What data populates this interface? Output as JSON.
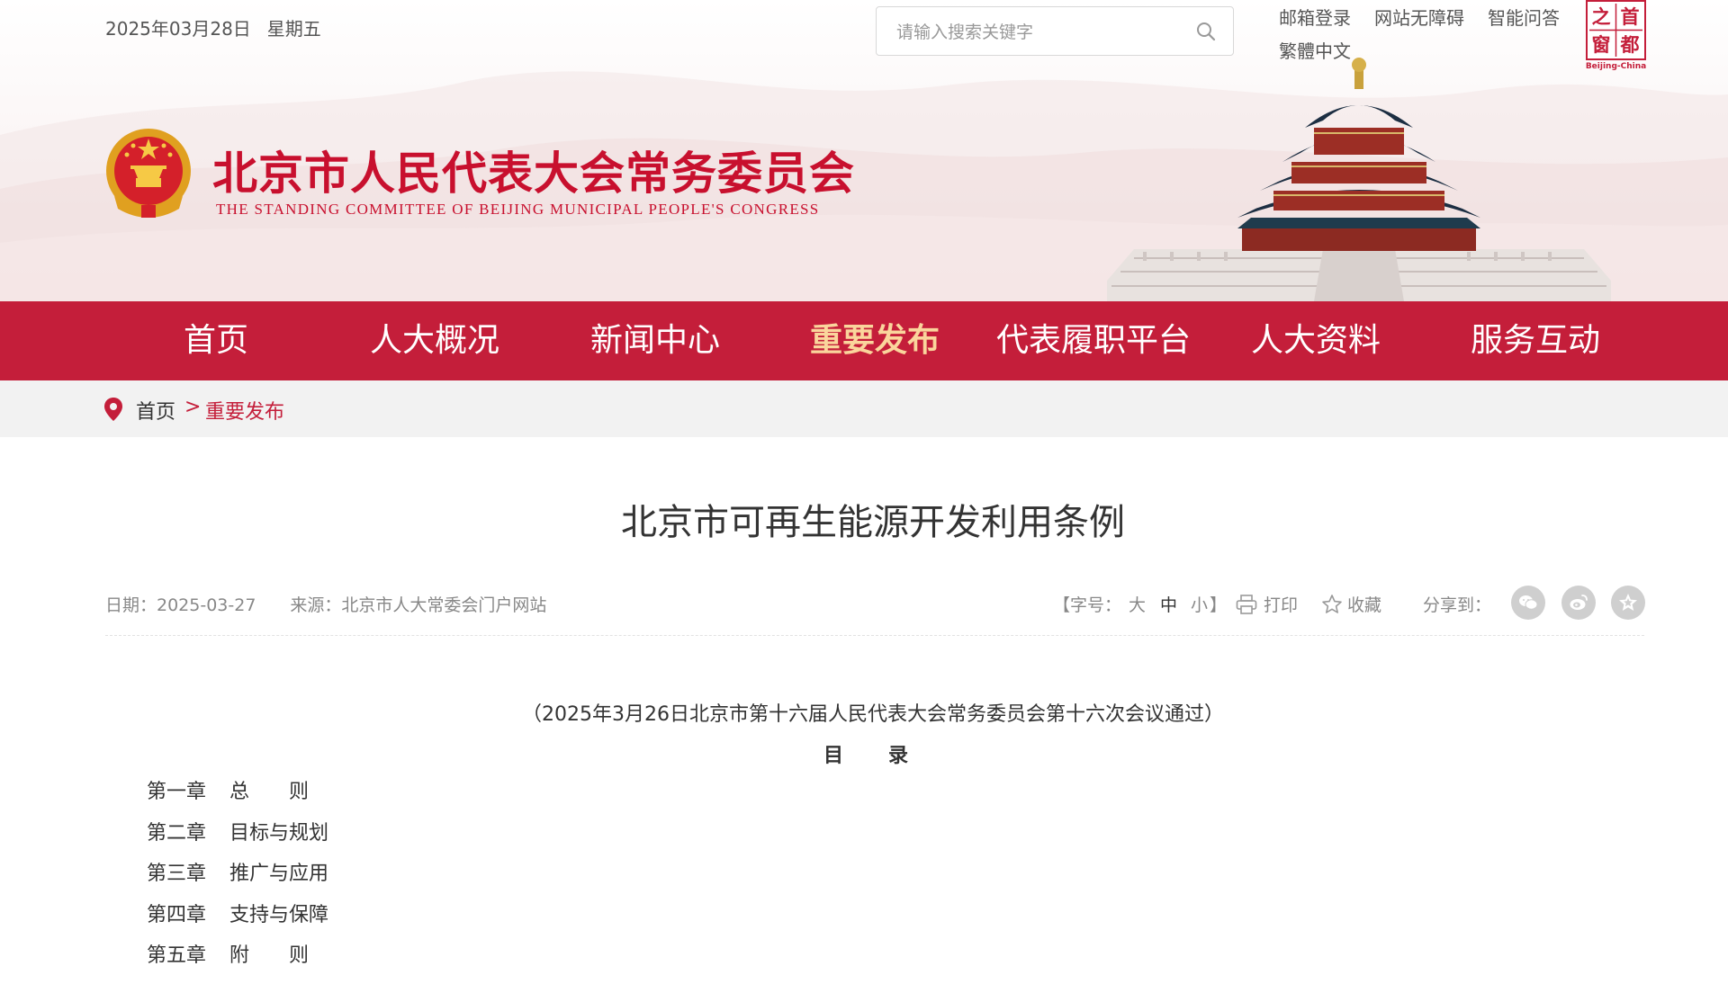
{
  "header": {
    "date": "2025年03月28日",
    "weekday": "星期五",
    "search_placeholder": "请输入搜索关键字",
    "links": [
      "邮箱登录",
      "网站无障碍",
      "智能问答"
    ],
    "lang_link": "繁體中文",
    "site_title": "北京市人民代表大会常务委员会",
    "site_title_en": "THE STANDING COMMITTEE OF BEIJING MUNICIPAL PEOPLE'S CONGRESS",
    "badge_text": [
      "首",
      "都",
      "之",
      "窗"
    ],
    "badge_caption": "Beijing-China"
  },
  "nav": {
    "items": [
      "首页",
      "人大概况",
      "新闻中心",
      "重要发布",
      "代表履职平台",
      "人大资料",
      "服务互动"
    ],
    "active": "重要发布"
  },
  "breadcrumb": {
    "home": "首页",
    "separator": ">",
    "current": "重要发布"
  },
  "article": {
    "title": "北京市可再生能源开发利用条例",
    "date": "日期：2025-03-27",
    "source": "来源：北京市人大常委会门户网站",
    "font_size": {
      "label": "【字号：",
      "large": "大",
      "medium": "中",
      "small": "小",
      "close": "】",
      "selected": "中"
    },
    "print_label": "打印",
    "favorite_label": "收藏",
    "share_label": "分享到：",
    "passed_note": "（2025年3月26日北京市第十六届人民代表大会常务委员会第十六次会议通过）",
    "toc_title": "目录",
    "toc": [
      {
        "chapter": "第一章",
        "name": "总　　则"
      },
      {
        "chapter": "第二章",
        "name": "目标与规划"
      },
      {
        "chapter": "第三章",
        "name": "推广与应用"
      },
      {
        "chapter": "第四章",
        "name": "支持与保障"
      },
      {
        "chapter": "第五章",
        "name": "附　　则"
      }
    ]
  },
  "colors": {
    "brand_red": "#c41e3a",
    "nav_active": "#fad59c",
    "meta_gray": "#888888"
  },
  "icons": [
    "search-icon",
    "location-pin-icon",
    "print-icon",
    "star-icon",
    "wechat-icon",
    "weibo-icon",
    "favorite-share-icon"
  ]
}
